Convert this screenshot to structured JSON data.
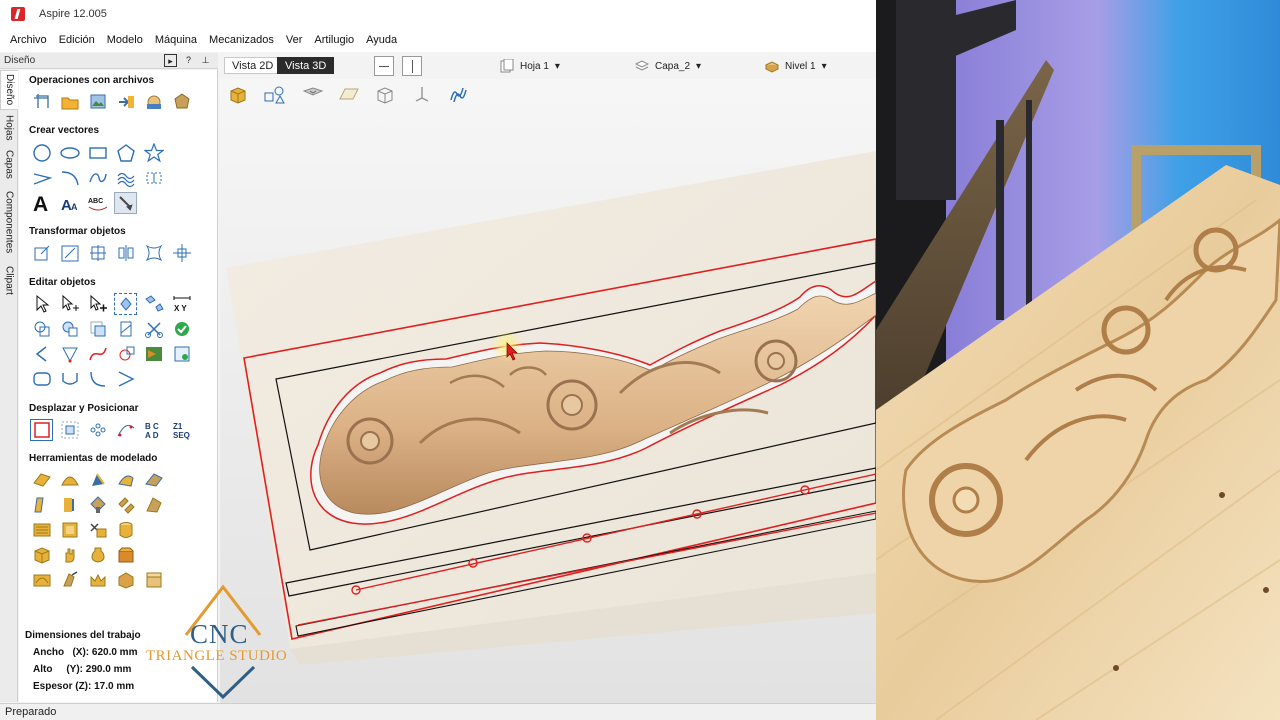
{
  "window": {
    "title": "Aspire 12.005"
  },
  "menu": [
    "Archivo",
    "Edición",
    "Modelo",
    "Máquina",
    "Mecanizados",
    "Ver",
    "Artilugio",
    "Ayuda"
  ],
  "panel": {
    "header": "Diseño",
    "tabs": [
      "Diseño",
      "Hojas",
      "Capas",
      "Componentes",
      "Clipart"
    ],
    "sections": {
      "file_ops": "Operaciones con archivos",
      "create_vectors": "Crear vectores",
      "transform": "Transformar objetos",
      "edit": "Editar objetos",
      "move": "Desplazar y Posicionar",
      "modeling": "Herramientas de modelado"
    },
    "dims": {
      "title": "Dimensiones del trabajo",
      "width": "Ancho   (X): 620.0 mm",
      "height": "Alto     (Y): 290.0 mm",
      "thickness": "Espesor (Z): 17.0 mm"
    }
  },
  "viewport": {
    "tab_2d": "Vista 2D",
    "tab_3d": "Vista 3D",
    "sheet": "Hoja 1",
    "layer": "Capa_2",
    "level": "Nivel 1"
  },
  "status": "Preparado",
  "logo": {
    "title": "CNC",
    "subtitle": "TRIANGLE STUDIO"
  },
  "colors": {
    "accent": "#d9262b",
    "toolpath": "#e02020",
    "logo_blue": "#2f5f86",
    "logo_orange": "#e39a2f"
  }
}
